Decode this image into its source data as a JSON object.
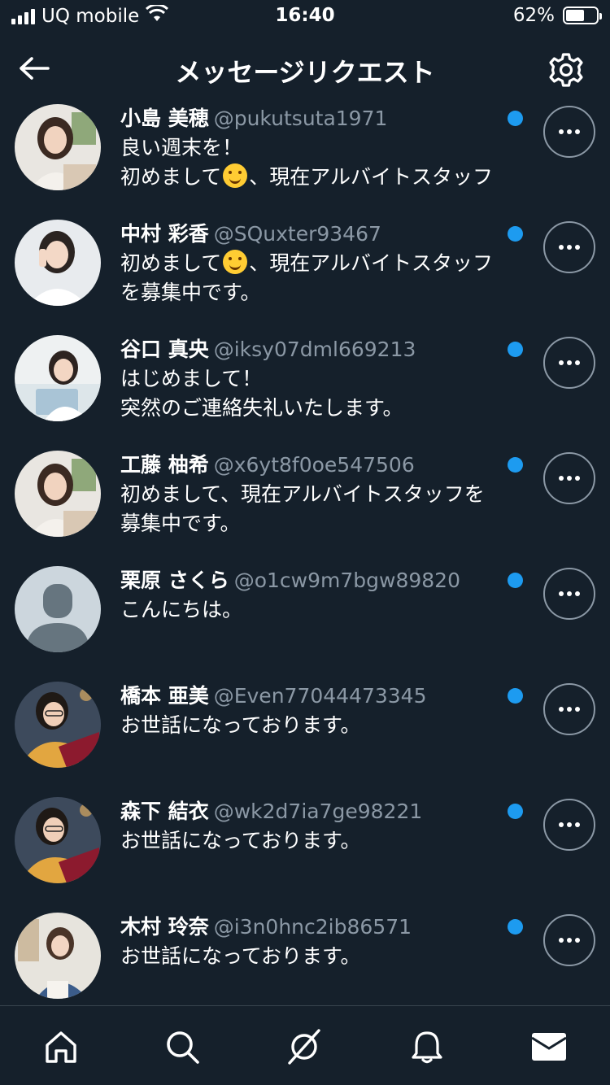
{
  "status": {
    "carrier": "UQ mobile",
    "time": "16:40",
    "battery": "62%",
    "battery_level": 0.62
  },
  "header": {
    "title": "メッセージリクエスト"
  },
  "requests": [
    {
      "name": "小島 美穂",
      "handle": "@pukutsuta1971",
      "line1": "良い週末を！",
      "line2a": "初めまして",
      "line2b": "、現在アルバイトスタッフ",
      "emoji_line": 2
    },
    {
      "name": "中村 彩香",
      "handle": "@SQuxter93467",
      "line1a": "初めまして",
      "line1b": "、現在アルバイトスタッフ",
      "line2": "を募集中です。",
      "emoji_line": 1
    },
    {
      "name": "谷口 真央",
      "handle": "@iksy07dml669213",
      "line1": "はじめまして！",
      "line2": "突然のご連絡失礼いたします。"
    },
    {
      "name": "工藤 柚希",
      "handle": "@x6yt8f0oe547506",
      "line1": "初めまして、現在アルバイトスタッフを",
      "line2": "募集中です。"
    },
    {
      "name": "栗原 さくら",
      "handle": "@o1cw9m7bgw89820",
      "line1": "こんにちは。",
      "line2": ""
    },
    {
      "name": "橋本 亜美",
      "handle": "@Even77044473345",
      "line1": "お世話になっております。",
      "line2": ""
    },
    {
      "name": "森下 結衣",
      "handle": "@wk2d7ia7ge98221",
      "line1": "お世話になっております。",
      "line2": ""
    },
    {
      "name": "木村 玲奈",
      "handle": "@i3n0hnc2ib86571",
      "line1": "お世話になっております。",
      "line2": ""
    }
  ],
  "colors": {
    "background": "#15202b",
    "accent": "#1d9bf0",
    "secondary_text": "#8b98a5"
  },
  "icons": {
    "back": "arrow-left-icon",
    "settings": "gear-icon",
    "more": "more-horizontal-icon",
    "unread": "unread-dot-icon",
    "tabs": [
      "home-icon",
      "search-icon",
      "spaces-icon",
      "bell-icon",
      "envelope-icon"
    ]
  }
}
